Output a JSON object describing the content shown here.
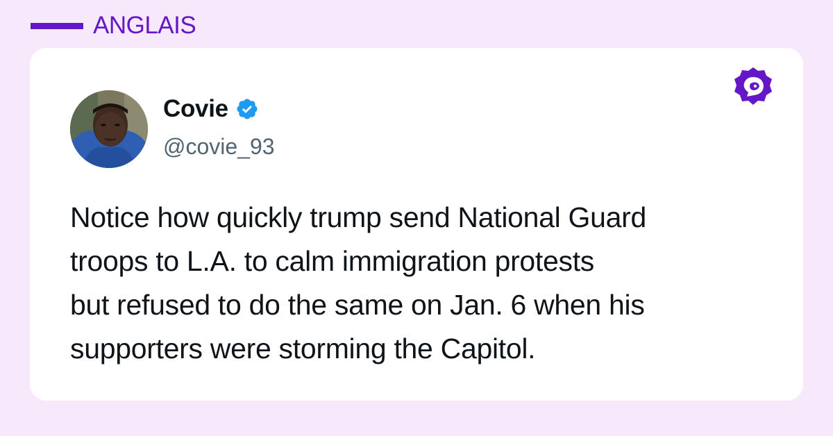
{
  "header": {
    "language_label": "ANGLAIS",
    "accent_color": "#6417c7",
    "background_color": "#f8e8fb"
  },
  "tweet": {
    "display_name": "Covie",
    "handle": "@covie_93",
    "verified": true,
    "verified_color": "#1d9bf0",
    "text": "Notice how quickly trump send National Guard\ntroops  to L.A. to calm immigration protests\nbut refused to do the same on Jan. 6 when his\nsupporters were storming the Capitol.",
    "avatar_icon": "user-avatar-photo"
  },
  "brand": {
    "logo_icon": "brand-logo-icon"
  }
}
